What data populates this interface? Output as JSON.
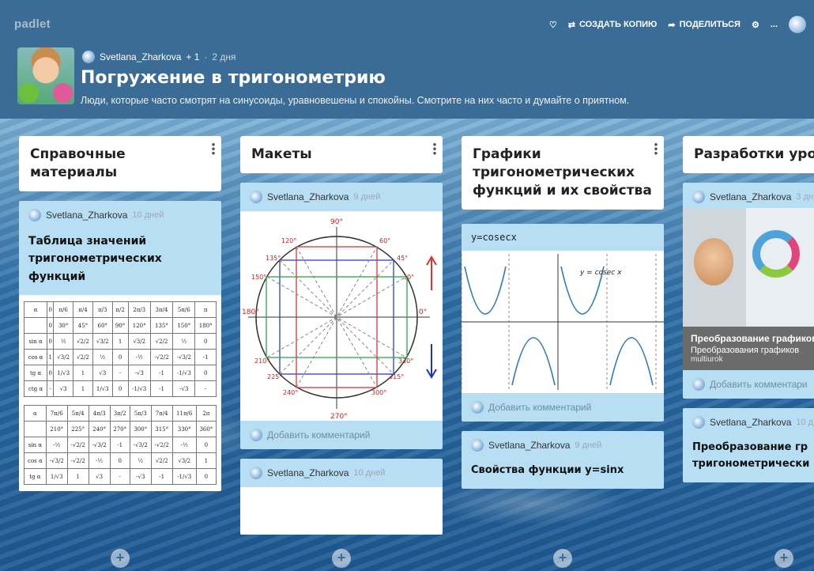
{
  "app": {
    "logo": "padlet"
  },
  "toolbar": {
    "copy_label": "СОЗДАТЬ КОПИЮ",
    "share_label": "ПОДЕЛИТЬСЯ",
    "more_label": "..."
  },
  "board": {
    "author": "Svetlana_Zharkova",
    "plus": "+ 1",
    "sep": "·",
    "age": "2 дня",
    "title": "Погружение в тригонометрию",
    "description": "Люди, которые часто смотрят на синусоиды, уравновешены и спокойны. Смотрите на них часто и думайте о приятном."
  },
  "columns": [
    {
      "title": "Справочные материалы",
      "cards": [
        {
          "author": "Svetlana_Zharkova",
          "ago": "10 дней",
          "title": "Таблица значений тригонометрических функций"
        }
      ]
    },
    {
      "title": "Макеты",
      "cards": [
        {
          "author": "Svetlana_Zharkova",
          "ago": "9 дней",
          "comment": "Добавить комментарий"
        },
        {
          "author": "Svetlana_Zharkova",
          "ago": "10 дней"
        }
      ]
    },
    {
      "title": "Графики тригонометрических функций и их свойства",
      "cards": [
        {
          "mono_title": "y=cosecx",
          "graph_label": "y = cosec x",
          "comment": "Добавить комментарий"
        },
        {
          "author": "Svetlana_Zharkova",
          "ago": "9 дней",
          "title": "Свойства функции y=sinx"
        }
      ]
    },
    {
      "title": "Разработки уро",
      "cards": [
        {
          "author": "Svetlana_Zharkova",
          "ago": "3 дн",
          "link_title": "Преобразование графиков",
          "link_desc": "Преобразования графиков",
          "link_site": "multiurok",
          "comment": "Добавить комментари"
        },
        {
          "author": "Svetlana_Zharkova",
          "ago": "10 д",
          "title": "Преобразование гр тригонометрически"
        }
      ]
    }
  ],
  "add_button": "+"
}
